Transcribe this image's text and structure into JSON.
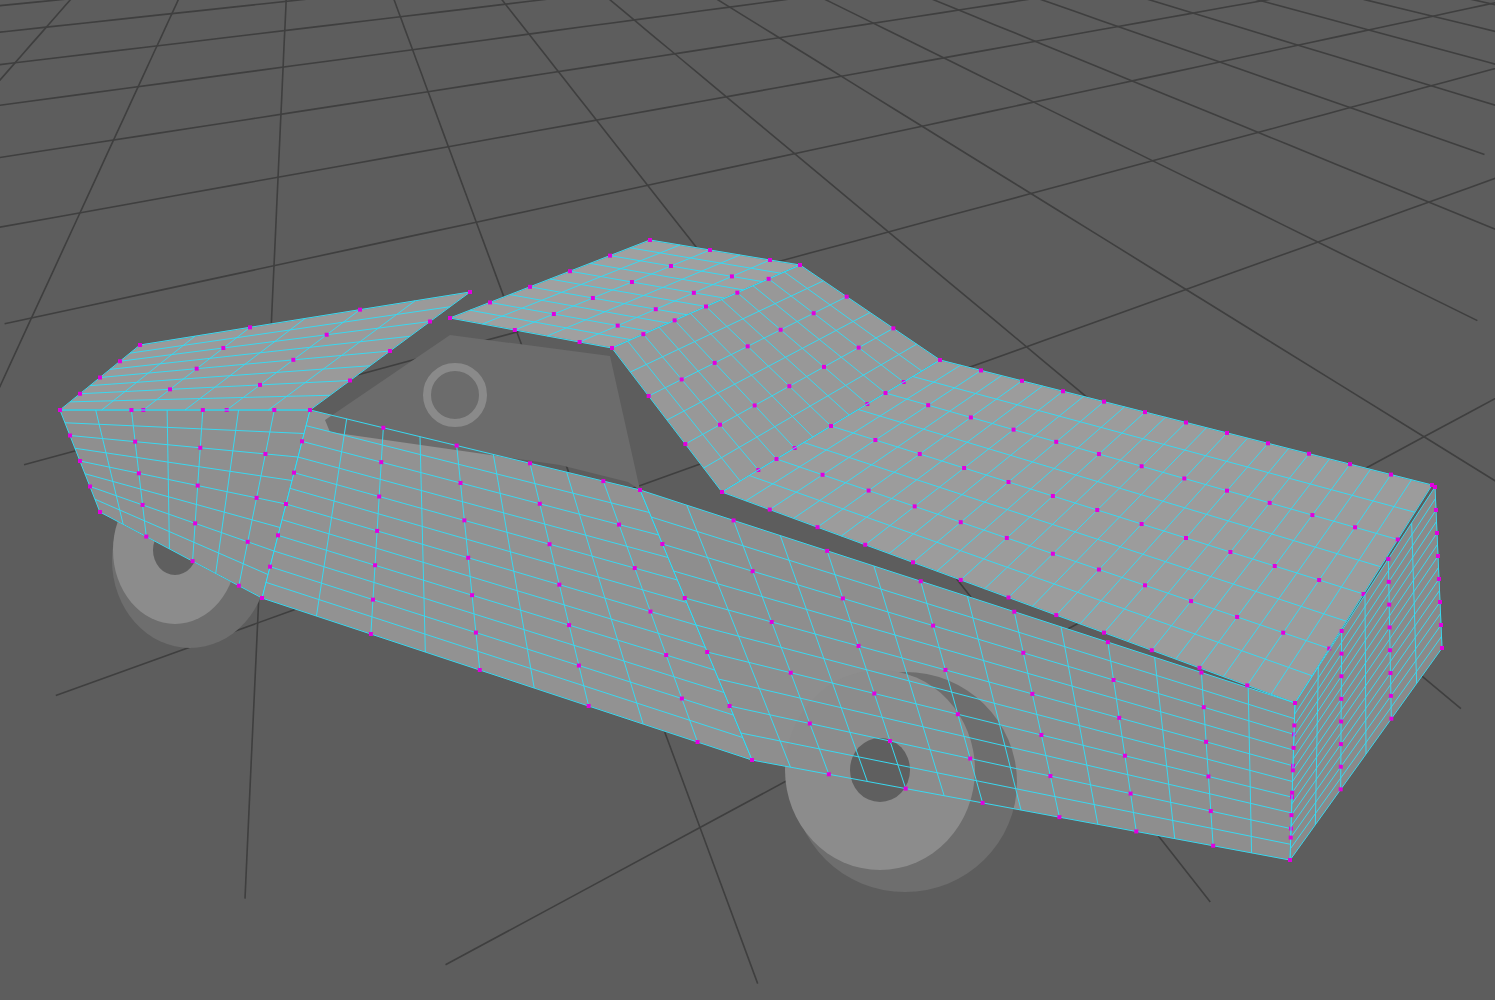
{
  "viewport": {
    "show_grid": true,
    "wireframe_on_shaded": true
  }
}
